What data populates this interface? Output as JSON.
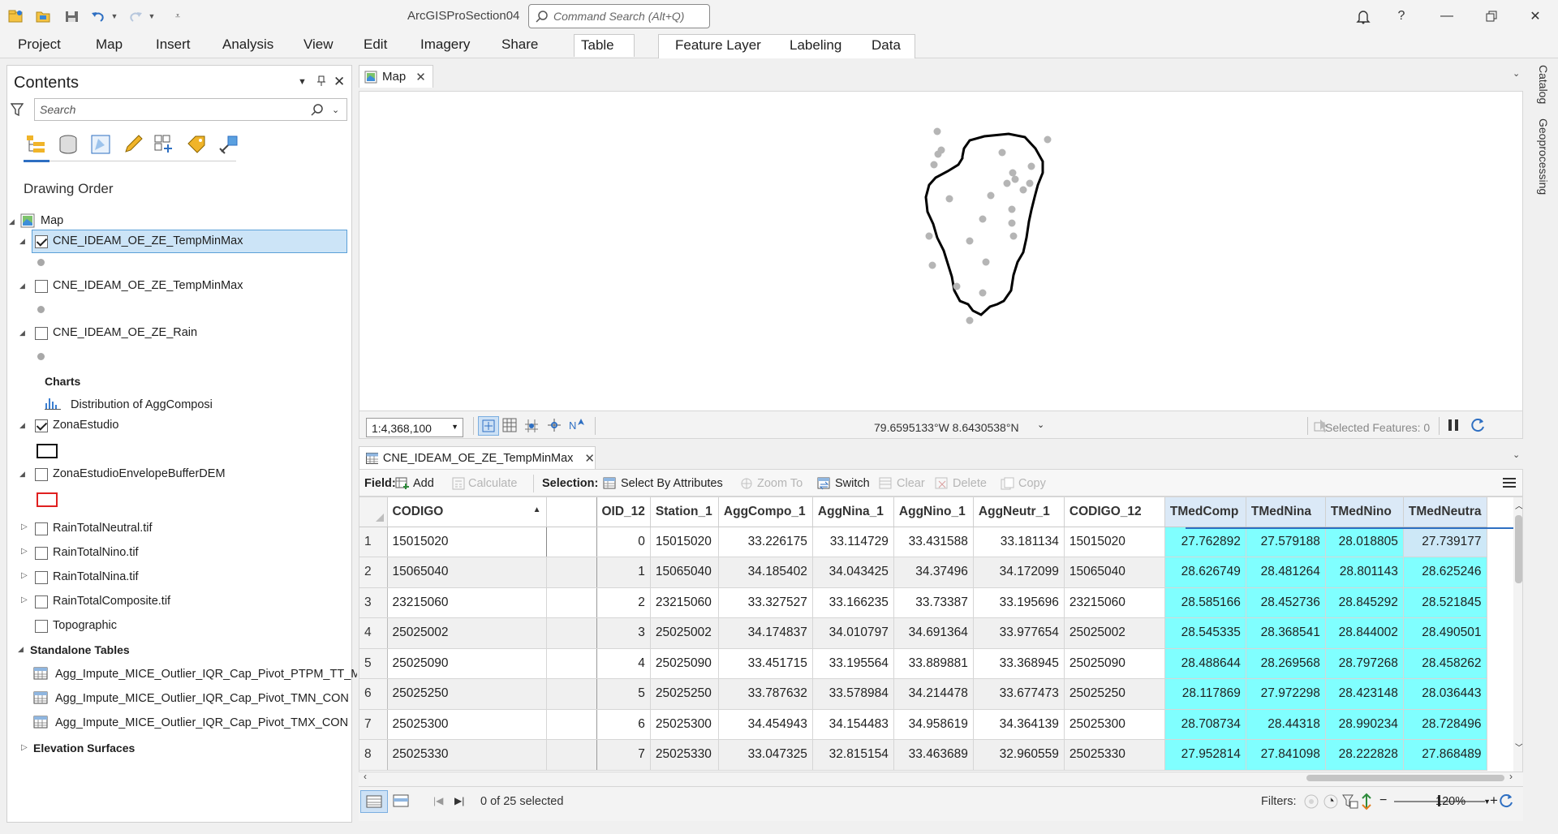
{
  "app": {
    "title": "ArcGISProSection04",
    "command_search_placeholder": "Command Search (Alt+Q)"
  },
  "ribbon": {
    "tabs": [
      "Project",
      "Map",
      "Insert",
      "Analysis",
      "View",
      "Edit",
      "Imagery",
      "Share",
      "Table"
    ],
    "context_tabs": [
      "Feature Layer",
      "Labeling",
      "Data"
    ]
  },
  "contents": {
    "title": "Contents",
    "search_placeholder": "Search",
    "drawing_order": "Drawing Order",
    "map_label": "Map",
    "layers": [
      {
        "name": "CNE_IDEAM_OE_ZE_TempMinMax",
        "checked": true
      },
      {
        "name": "CNE_IDEAM_OE_ZE_TempMinMax",
        "checked": false
      },
      {
        "name": "CNE_IDEAM_OE_ZE_Rain",
        "checked": false
      }
    ],
    "charts_label": "Charts",
    "chart_item": "Distribution of AggComposi",
    "zona": "ZonaEstudio",
    "zona_buffer": "ZonaEstudioEnvelopeBufferDEM",
    "rasters": [
      "RainTotalNeutral.tif",
      "RainTotalNino.tif",
      "RainTotalNina.tif",
      "RainTotalComposite.tif"
    ],
    "topographic": "Topographic",
    "standalone_tables": "Standalone Tables",
    "tables": [
      "Agg_Impute_MICE_Outlier_IQR_Cap_Pivot_PTPM_TT_M",
      "Agg_Impute_MICE_Outlier_IQR_Cap_Pivot_TMN_CON",
      "Agg_Impute_MICE_Outlier_IQR_Cap_Pivot_TMX_CON"
    ],
    "elevation": "Elevation Surfaces"
  },
  "map": {
    "tab": "Map",
    "scale": "1:4,368,100",
    "coordinates": "79.6595133°W 8.6430538°N",
    "selected_features": "Selected Features: 0"
  },
  "side_panels": [
    "Catalog",
    "Geoprocessing"
  ],
  "table": {
    "tab": "CNE_IDEAM_OE_ZE_TempMinMax",
    "field_label": "Field:",
    "add": "Add",
    "calculate": "Calculate",
    "selection_label": "Selection:",
    "select_by_attributes": "Select By Attributes",
    "zoom_to": "Zoom To",
    "switch": "Switch",
    "clear": "Clear",
    "delete": "Delete",
    "copy": "Copy",
    "columns": [
      "CODIGO",
      "",
      "OID_12",
      "Station_1",
      "AggCompo_1",
      "AggNina_1",
      "AggNino_1",
      "AggNeutr_1",
      "CODIGO_12",
      "TMedComp",
      "TMedNina",
      "TMedNino",
      "TMedNeutra"
    ],
    "rows": [
      [
        "1",
        "15015020",
        "",
        "0",
        "15015020",
        "33.226175",
        "33.114729",
        "33.431588",
        "33.181134",
        "15015020",
        "27.762892",
        "27.579188",
        "28.018805",
        "27.739177"
      ],
      [
        "2",
        "15065040",
        "",
        "1",
        "15065040",
        "34.185402",
        "34.043425",
        "34.37496",
        "34.172099",
        "15065040",
        "28.626749",
        "28.481264",
        "28.801143",
        "28.625246"
      ],
      [
        "3",
        "23215060",
        "",
        "2",
        "23215060",
        "33.327527",
        "33.166235",
        "33.73387",
        "33.195696",
        "23215060",
        "28.585166",
        "28.452736",
        "28.845292",
        "28.521845"
      ],
      [
        "4",
        "25025002",
        "",
        "3",
        "25025002",
        "34.174837",
        "34.010797",
        "34.691364",
        "33.977654",
        "25025002",
        "28.545335",
        "28.368541",
        "28.844002",
        "28.490501"
      ],
      [
        "5",
        "25025090",
        "",
        "4",
        "25025090",
        "33.451715",
        "33.195564",
        "33.889881",
        "33.368945",
        "25025090",
        "28.488644",
        "28.269568",
        "28.797268",
        "28.458262"
      ],
      [
        "6",
        "25025250",
        "",
        "5",
        "25025250",
        "33.787632",
        "33.578984",
        "34.214478",
        "33.677473",
        "25025250",
        "28.117869",
        "27.972298",
        "28.423148",
        "28.036443"
      ],
      [
        "7",
        "25025300",
        "",
        "6",
        "25025300",
        "34.454943",
        "34.154483",
        "34.958619",
        "34.364139",
        "25025300",
        "28.708734",
        "28.44318",
        "28.990234",
        "28.728496"
      ],
      [
        "8",
        "25025330",
        "",
        "7",
        "25025330",
        "33.047325",
        "32.815154",
        "33.463689",
        "32.960559",
        "25025330",
        "27.952814",
        "27.841098",
        "28.222828",
        "27.868489"
      ]
    ],
    "selection_status": "0 of 25 selected",
    "filters_label": "Filters:",
    "zoom": "120%"
  }
}
